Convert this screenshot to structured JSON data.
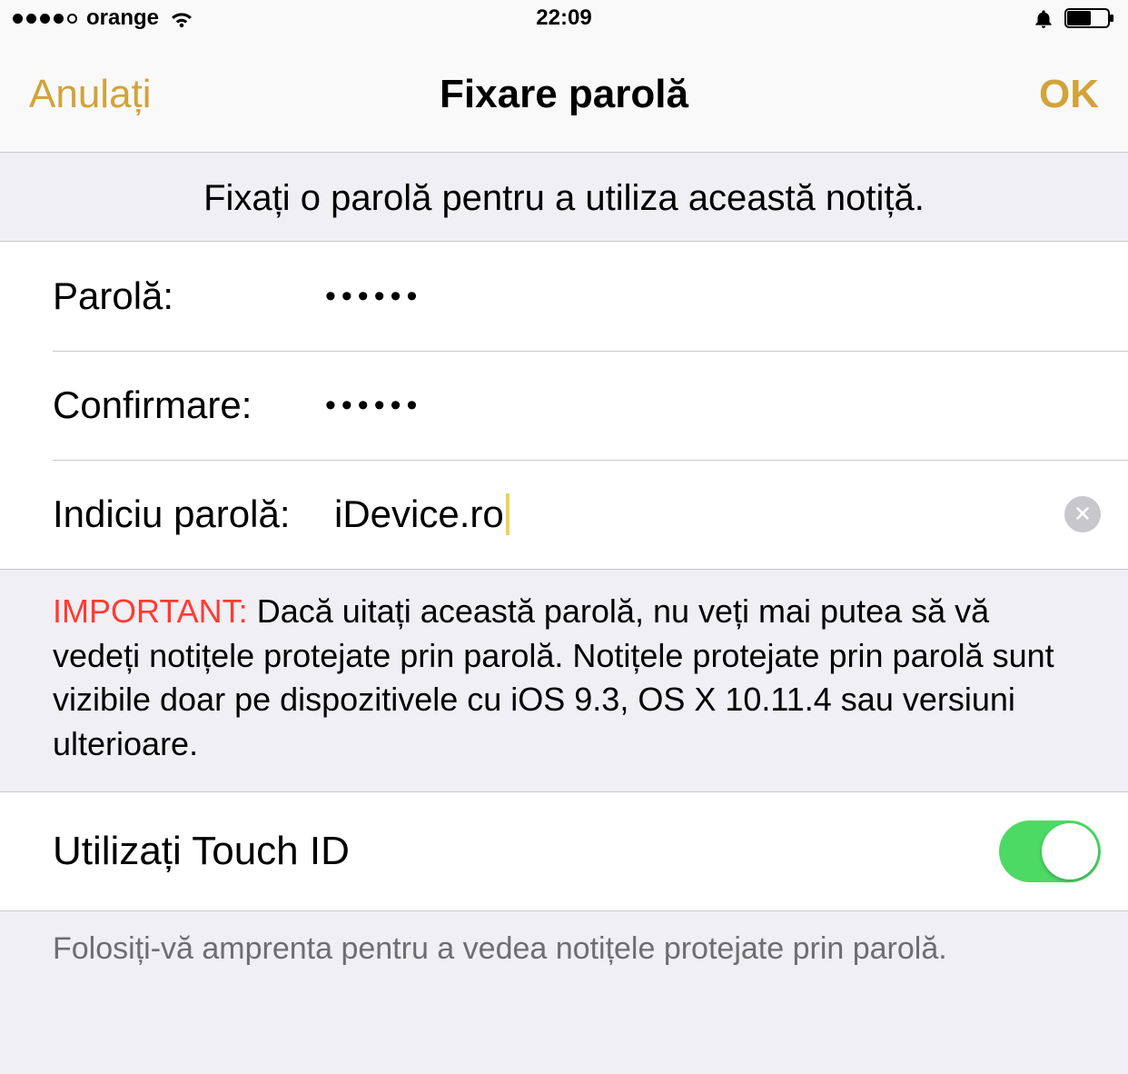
{
  "statusbar": {
    "carrier": "orange",
    "time": "22:09",
    "signal_filled": 4,
    "signal_total": 5,
    "alarm": true,
    "battery_level": 0.55
  },
  "navbar": {
    "cancel": "Anulați",
    "title": "Fixare parolă",
    "ok": "OK"
  },
  "header_text": "Fixați o parolă pentru a utiliza această notiță.",
  "form": {
    "password_label": "Parolă:",
    "password_value": "••••••",
    "confirm_label": "Confirmare:",
    "confirm_value": "••••••",
    "hint_label": "Indiciu parolă:",
    "hint_value": "iDevice.ro"
  },
  "note": {
    "important_label": "IMPORTANT:",
    "text": "Dacă uitați această parolă, nu veți mai putea să vă vedeți notițele protejate prin parolă. Notițele protejate prin parolă sunt vizibile doar pe dispozitivele cu iOS 9.3, OS X 10.11.4 sau versiuni ulterioare."
  },
  "touchid": {
    "label": "Utilizați Touch ID",
    "enabled": true
  },
  "touchid_footer": "Folosiți-vă amprenta pentru a vedea notițele protejate prin parolă."
}
